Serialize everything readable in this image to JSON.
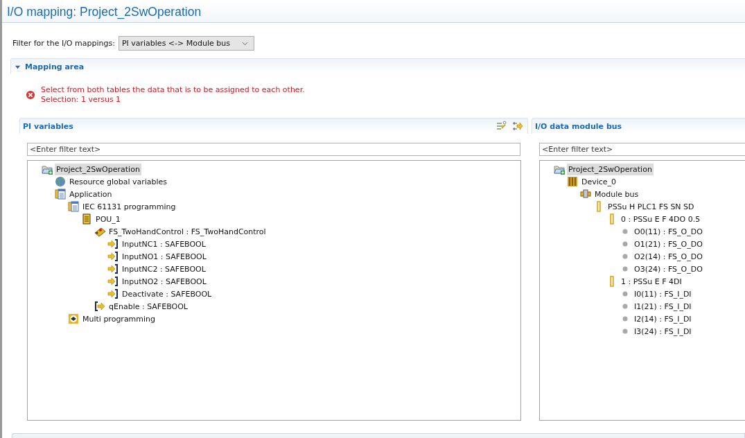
{
  "window": {
    "title": "I/O mapping: Project_2SwOperation"
  },
  "filter": {
    "label": "Filter for the I/O mappings:",
    "value": "PI variables <-> Module bus"
  },
  "section": {
    "title": "Mapping area",
    "expanded": true
  },
  "message": {
    "kind": "error",
    "lines": [
      "Select from both tables the data that is to be assigned to each other.",
      "Selection: 1 versus 1"
    ]
  },
  "panels": [
    {
      "title": "PI variables",
      "tools": [
        {
          "kind": "auto-map"
        },
        {
          "kind": "map"
        }
      ],
      "filter_placeholder": "<Enter filter text>",
      "tree": [
        {
          "label": "Project_2SwOperation",
          "kind": "project",
          "selected": true,
          "children": [
            {
              "label": "Resource global variables",
              "kind": "globe",
              "selected": false
            },
            {
              "label": "Application",
              "kind": "application",
              "selected": false,
              "children": [
                {
                  "label": "IEC 61131 programming",
                  "kind": "application",
                  "selected": false,
                  "children": [
                    {
                      "label": "POU_1",
                      "kind": "pou",
                      "selected": false,
                      "children": [
                        {
                          "label": "FS_TwoHandControl : FS_TwoHandControl",
                          "kind": "block",
                          "selected": false,
                          "children": [
                            {
                              "label": "InputNC1 : SAFEBOOL",
                              "kind": "input",
                              "selected": false
                            },
                            {
                              "label": "InputNO1 : SAFEBOOL",
                              "kind": "input",
                              "selected": false
                            },
                            {
                              "label": "InputNC2 : SAFEBOOL",
                              "kind": "input",
                              "selected": false
                            },
                            {
                              "label": "InputNO2 : SAFEBOOL",
                              "kind": "input",
                              "selected": false
                            },
                            {
                              "label": "Deactivate : SAFEBOOL",
                              "kind": "input",
                              "selected": false
                            }
                          ]
                        },
                        {
                          "label": "qEnable : SAFEBOOL",
                          "kind": "output",
                          "selected": false
                        }
                      ]
                    }
                  ]
                },
                {
                  "label": "Multi programming",
                  "kind": "multi",
                  "selected": false
                }
              ]
            }
          ]
        }
      ]
    },
    {
      "title": "I/O data module bus",
      "filter_placeholder": "<Enter filter text>",
      "tree": [
        {
          "label": "Project_2SwOperation",
          "kind": "project",
          "selected": true,
          "children": [
            {
              "label": "Device_0",
              "kind": "device",
              "selected": false,
              "children": [
                {
                  "label": "Module bus",
                  "kind": "bus",
                  "selected": false,
                  "children": [
                    {
                      "label": "PSSu H PLC1 FS SN SD",
                      "kind": "module",
                      "selected": false,
                      "children": [
                        {
                          "label": "0 : PSSu E F 4DO 0.5",
                          "kind": "module",
                          "selected": false,
                          "children": [
                            {
                              "label": "O0(11) : FS_O_DO",
                              "kind": "channel",
                              "selected": false
                            },
                            {
                              "label": "O1(21) : FS_O_DO",
                              "kind": "channel",
                              "selected": false
                            },
                            {
                              "label": "O2(14) : FS_O_DO",
                              "kind": "channel",
                              "selected": false
                            },
                            {
                              "label": "O3(24) : FS_O_DO",
                              "kind": "channel",
                              "selected": false
                            }
                          ]
                        },
                        {
                          "label": "1 : PSSu E F 4DI",
                          "kind": "module",
                          "selected": false,
                          "children": [
                            {
                              "label": "I0(11) : FS_I_DI",
                              "kind": "channel",
                              "selected": false
                            },
                            {
                              "label": "I1(21) : FS_I_DI",
                              "kind": "channel",
                              "selected": false
                            },
                            {
                              "label": "I2(14) : FS_I_DI",
                              "kind": "channel",
                              "selected": false
                            },
                            {
                              "label": "I3(24) : FS_I_DI",
                              "kind": "channel",
                              "selected": false
                            }
                          ]
                        }
                      ]
                    }
                  ]
                }
              ]
            }
          ]
        }
      ]
    }
  ]
}
